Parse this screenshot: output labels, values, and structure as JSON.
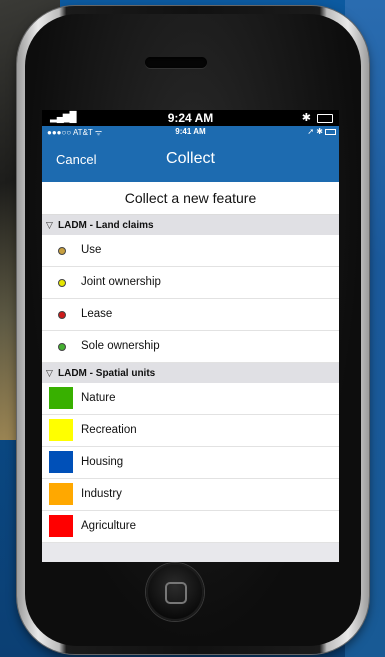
{
  "device": {
    "outer_time": "9:24 AM"
  },
  "app": {
    "status": {
      "carrier": "●●●○○ AT&T ᯤ",
      "time": "9:41 AM",
      "right_icons": "➚ ✱"
    },
    "nav": {
      "cancel_label": "Cancel",
      "title": "Collect"
    },
    "subtitle": "Collect a new feature",
    "sections": [
      {
        "title": "LADM - Land claims",
        "items": [
          {
            "label": "Use",
            "color": "#c8a040"
          },
          {
            "label": "Joint ownership",
            "color": "#e6e600"
          },
          {
            "label": "Lease",
            "color": "#cc1a1a"
          },
          {
            "label": "Sole ownership",
            "color": "#44b030"
          }
        ]
      },
      {
        "title": "LADM - Spatial units",
        "items": [
          {
            "label": "Nature",
            "color": "#38b000"
          },
          {
            "label": "Recreation",
            "color": "#ffff00"
          },
          {
            "label": "Housing",
            "color": "#0050b8"
          },
          {
            "label": "Industry",
            "color": "#ffa800"
          },
          {
            "label": "Agriculture",
            "color": "#ff0000"
          }
        ]
      }
    ]
  }
}
